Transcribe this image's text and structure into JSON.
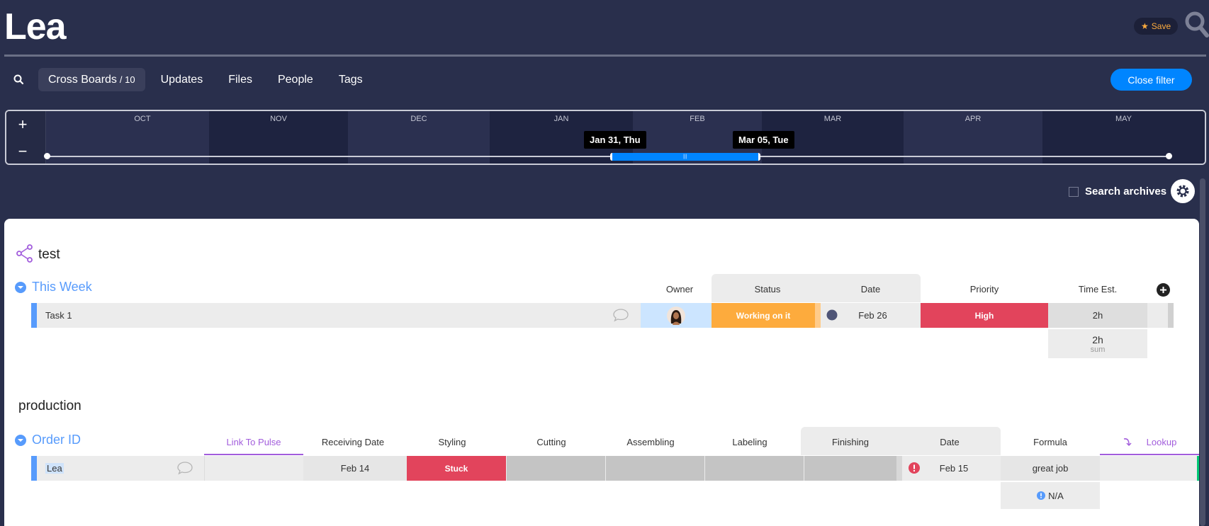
{
  "header": {
    "title": "Lea",
    "save_label": "Save"
  },
  "tabs": {
    "items": [
      {
        "label": "Cross Boards",
        "count": "/ 10",
        "active": true
      },
      {
        "label": "Updates"
      },
      {
        "label": "Files"
      },
      {
        "label": "People"
      },
      {
        "label": "Tags"
      }
    ],
    "close_filter": "Close filter"
  },
  "timeline": {
    "zoom_in": "+",
    "zoom_out": "−",
    "months": [
      "OCT",
      "NOV",
      "DEC",
      "JAN",
      "FEB",
      "MAR",
      "APR",
      "MAY"
    ],
    "range_start": "Jan 31, Thu",
    "range_end": "Mar 05, Tue"
  },
  "search_archives": {
    "label": "Search archives",
    "checked": false
  },
  "boards": [
    {
      "name": "test",
      "group": "This Week",
      "columns": [
        "Owner",
        "Status",
        "Date",
        "Priority",
        "Time Est."
      ],
      "row": {
        "name": "Task 1",
        "status": "Working on it",
        "date": "Feb 26",
        "priority": "High",
        "time_est": "2h"
      },
      "summary": {
        "value": "2h",
        "label": "sum"
      }
    },
    {
      "name": "production",
      "group": "Order ID",
      "columns": [
        "Link To Pulse",
        "Receiving Date",
        "Styling",
        "Cutting",
        "Assembling",
        "Labeling",
        "Finishing",
        "Date",
        "Formula",
        "Lookup"
      ],
      "row": {
        "name": "Lea",
        "receiving_date": "Feb 14",
        "styling": "Stuck",
        "date": "Feb 15",
        "formula": "great job"
      },
      "summary": {
        "value": "N/A"
      }
    }
  ],
  "colors": {
    "background": "#292f4c",
    "accent_blue": "#0085ff",
    "group_blue": "#579bfc",
    "working_on_it": "#fdab3d",
    "stuck_high": "#e2445c",
    "empty_status": "#c4c4c4",
    "link_purple": "#a25ddc"
  }
}
